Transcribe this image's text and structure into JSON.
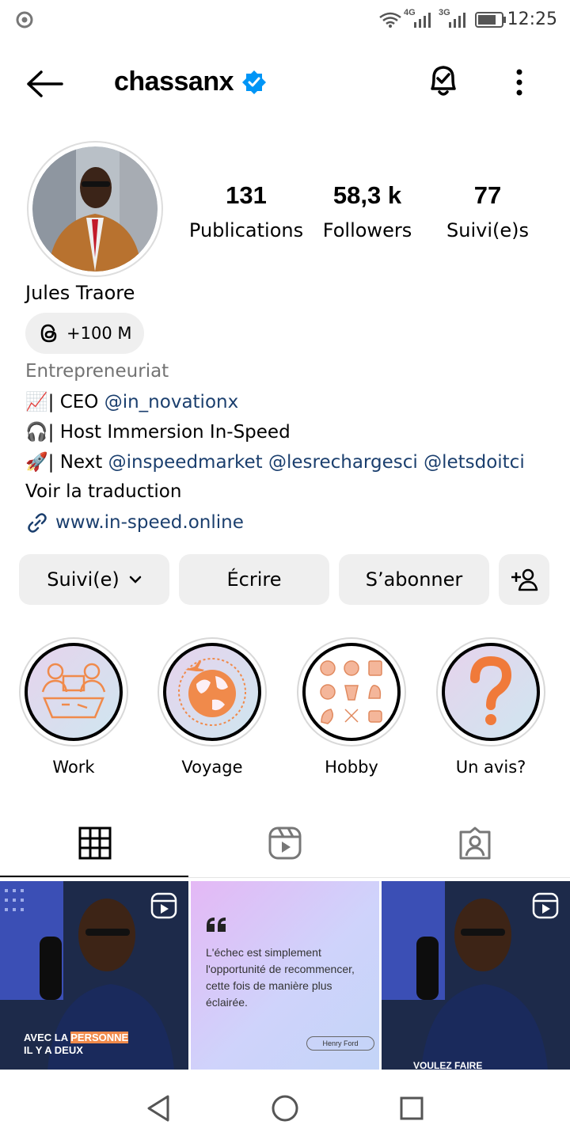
{
  "status_bar": {
    "time": "12:25",
    "net1": "4G",
    "net2": "3G"
  },
  "header": {
    "username": "chassanx",
    "verified": true
  },
  "stats": [
    {
      "value": "131",
      "label": "Publications"
    },
    {
      "value": "58,3 k",
      "label": "Followers"
    },
    {
      "value": "77",
      "label": "Suivi(e)s"
    }
  ],
  "profile": {
    "name": "Jules Traore",
    "threads_badge": "+100 M",
    "category": "Entrepreneuriat",
    "bio": [
      {
        "prefix": "| CEO ",
        "links": [
          "@in_novationx"
        ]
      },
      {
        "prefix": "| Host Immersion In-Speed",
        "links": []
      },
      {
        "prefix": "| Next ",
        "links": [
          "@inspeedmarket",
          "@lesrechargesci",
          "@letsdoitci"
        ]
      }
    ],
    "translate": "Voir la traduction",
    "website": "www.in-speed.online"
  },
  "actions": {
    "following": "Suivi(e)",
    "message": "Écrire",
    "subscribe": "S’abonner"
  },
  "highlights": [
    "Work",
    "Voyage",
    "Hobby",
    "Un avis?"
  ],
  "posts": [
    {
      "caption_1": "AVEC LA ",
      "caption_hl": "PERSONNE",
      "caption_2": "IL Y A DEUX"
    },
    {
      "quote": "L'échec est simplement l'opportunité de recommencer, cette fois de manière plus éclairée.",
      "author": "Henry Ford"
    },
    {
      "caption": "VOULEZ FAIRE"
    }
  ],
  "colors": {
    "verified": "#0095f6",
    "link": "#1b3f6e",
    "button_bg": "#efefef",
    "highlight_orange": "#f08a4b"
  }
}
